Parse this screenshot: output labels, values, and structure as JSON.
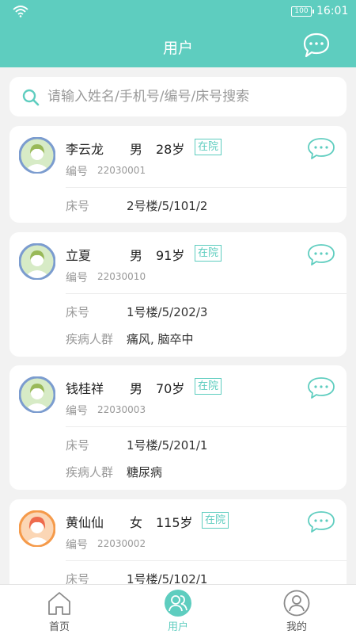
{
  "status_bar": {
    "battery": "100",
    "time": "16:01"
  },
  "header": {
    "title": "用户"
  },
  "search": {
    "placeholder": "请输入姓名/手机号/编号/床号搜索"
  },
  "labels": {
    "id": "编号",
    "bed": "床号",
    "disease": "疾病人群"
  },
  "patients": [
    {
      "name": "李云龙",
      "gender": "男",
      "age": "28岁",
      "status": "在院",
      "id": "22030001",
      "bed": "2号楼/5/101/2",
      "disease": ""
    },
    {
      "name": "立夏",
      "gender": "男",
      "age": "91岁",
      "status": "在院",
      "id": "22030010",
      "bed": "1号楼/5/202/3",
      "disease": "痛风, 脑卒中"
    },
    {
      "name": "钱桂祥",
      "gender": "男",
      "age": "70岁",
      "status": "在院",
      "id": "22030003",
      "bed": "1号楼/5/201/1",
      "disease": "糖尿病"
    },
    {
      "name": "黄仙仙",
      "gender": "女",
      "age": "115岁",
      "status": "在院",
      "id": "22030002",
      "bed": "1号楼/5/102/1",
      "disease": ""
    }
  ],
  "tabs": [
    {
      "label": "首页",
      "icon": "home-icon"
    },
    {
      "label": "用户",
      "icon": "users-icon"
    },
    {
      "label": "我的",
      "icon": "profile-icon"
    }
  ],
  "colors": {
    "accent": "#5ecdbf",
    "background": "#f2f2f2"
  }
}
